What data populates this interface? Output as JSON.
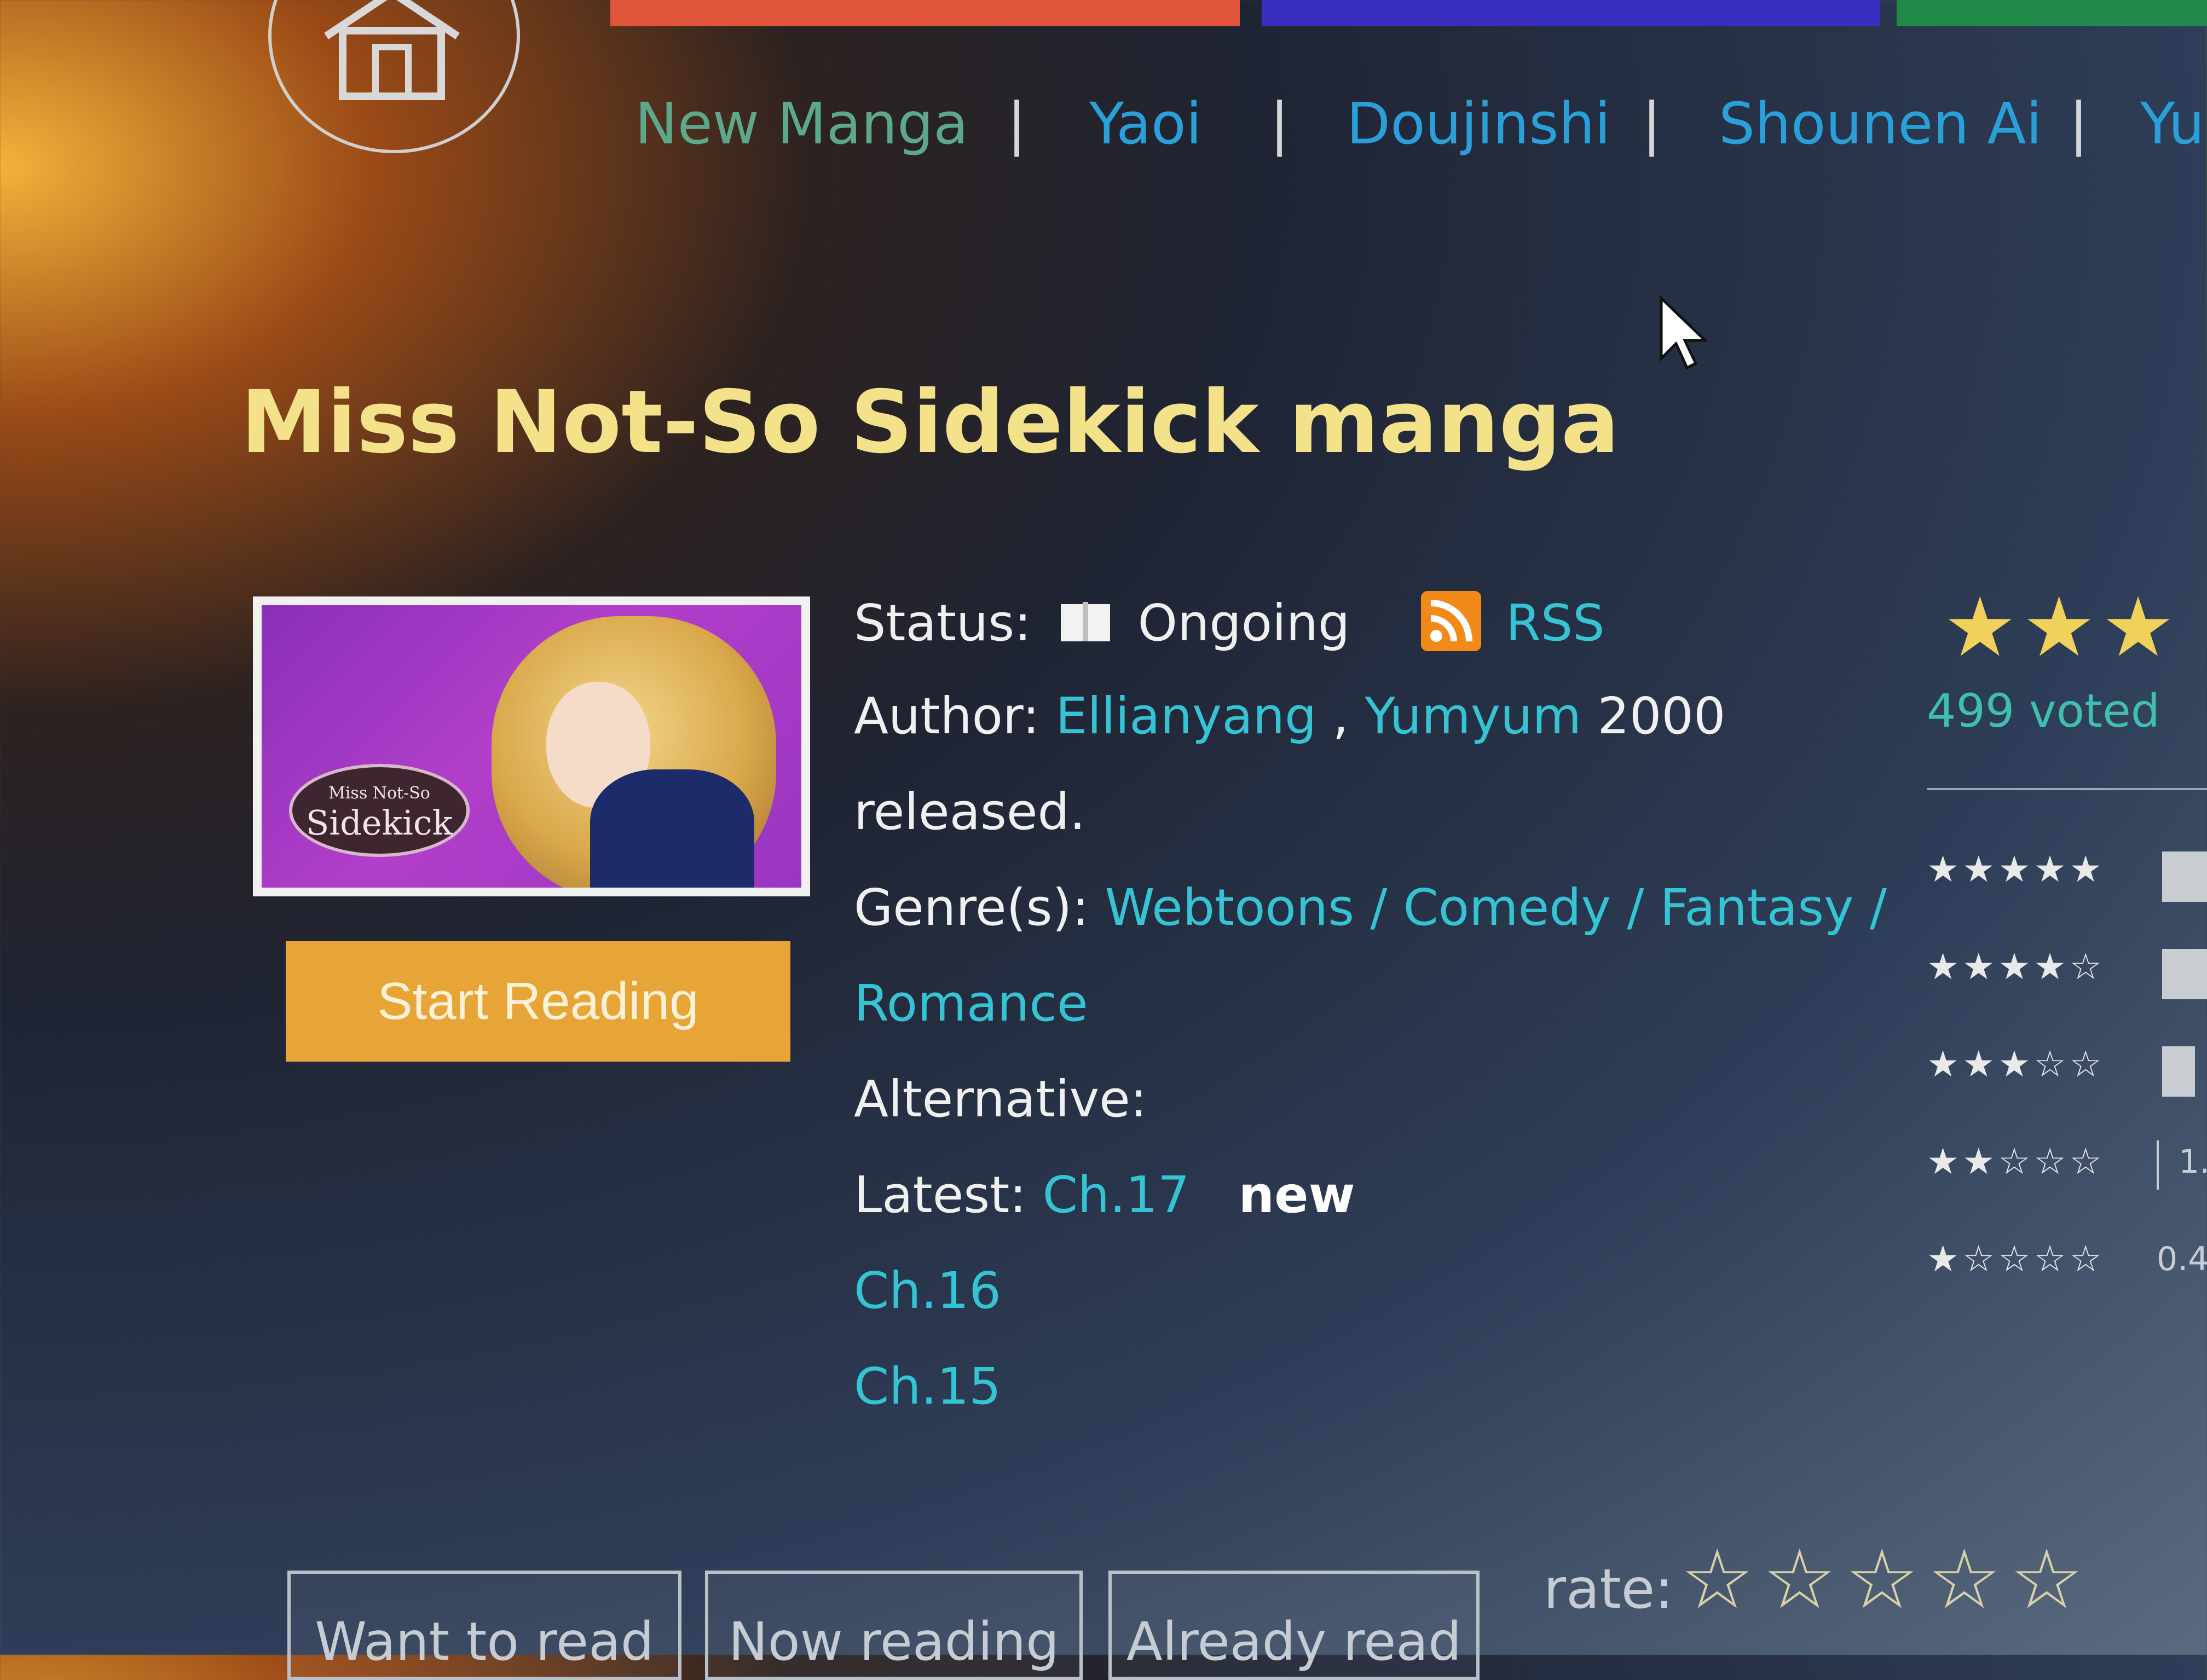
{
  "nav": {
    "home_icon": "home-icon",
    "links": [
      "New Manga",
      "Yaoi",
      "Doujinshi",
      "Shounen Ai",
      "Yu"
    ],
    "separator": "|",
    "color_bars": [
      "#e0543a",
      "#3a2ec0",
      "#1f8a4a"
    ]
  },
  "manga": {
    "title": "Miss Not-So Sidekick manga",
    "cover_logo_line1": "Miss Not-So",
    "cover_logo_line2": "Sidekick",
    "start_reading_label": "Start Reading"
  },
  "info": {
    "status_label": "Status:",
    "status_value": "Ongoing",
    "rss_label": "RSS",
    "author_label": "Author:",
    "author_1": "Ellianyang",
    "author_sep": ",",
    "author_2": "Yumyum",
    "author_rest": "2000",
    "author_rest_line2": "released.",
    "genre_label": "Genre(s):",
    "genres_line1": "Webtoons / Comedy / Fantasy /",
    "genres_line2": "Romance",
    "alternative_label": "Alternative:",
    "latest_label": "Latest:",
    "chapters": [
      "Ch.17",
      "Ch.16",
      "Ch.15"
    ],
    "new_badge": "new"
  },
  "rating": {
    "big_stars": "★★★",
    "voted": "499 voted",
    "distribution": [
      {
        "stars": "★★★★★",
        "value": ""
      },
      {
        "stars": "★★★★☆",
        "value": ""
      },
      {
        "stars": "★★★☆☆",
        "value": ""
      },
      {
        "stars": "★★☆☆☆",
        "value": "1."
      },
      {
        "stars": "★☆☆☆☆",
        "value": "0.4"
      }
    ]
  },
  "actions": {
    "want_to_read": "Want to read",
    "now_reading": "Now reading",
    "already_read": "Already read",
    "rate_label": "rate:",
    "rate_stars": "☆☆☆☆☆"
  }
}
